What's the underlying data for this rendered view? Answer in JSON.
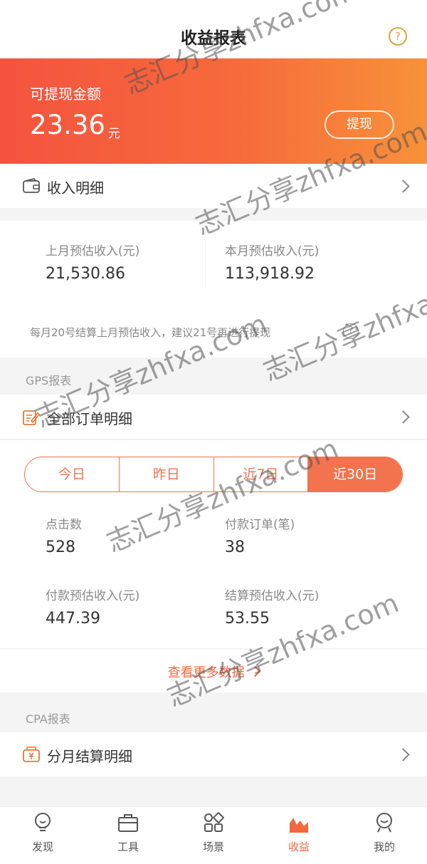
{
  "header": {
    "title": "收益报表",
    "help_symbol": "?"
  },
  "balance": {
    "label": "可提现金额",
    "amount": "23.36",
    "unit": "元",
    "withdraw_label": "提现"
  },
  "income_detail": {
    "label": "收入明细"
  },
  "estimates": {
    "last_month_label": "上月预估收入(元)",
    "last_month_value": "21,530.86",
    "this_month_label": "本月预估收入(元)",
    "this_month_value": "113,918.92",
    "note": "每月20号结算上月预估收入，建议21号再进行提现"
  },
  "gps": {
    "section_label": "GPS报表",
    "orders_label": "全部订单明细"
  },
  "periods": [
    "今日",
    "昨日",
    "近7日",
    "近30日"
  ],
  "active_period": "近30日",
  "stats": {
    "clicks_label": "点击数",
    "clicks_value": "528",
    "paid_orders_label": "付款订单(笔)",
    "paid_orders_value": "38",
    "paid_income_label": "付款预估收入(元)",
    "paid_income_value": "447.39",
    "settled_income_label": "结算预估收入(元)",
    "settled_income_value": "53.55"
  },
  "more_data_label": "查看更多数据",
  "cpa": {
    "section_label": "CPA报表",
    "monthly_label": "分月结算明细"
  },
  "tabs": [
    "发现",
    "工具",
    "场景",
    "收益",
    "我的"
  ],
  "active_tab": "收益",
  "watermark": "志汇分享zhfxa.com",
  "colors": {
    "accent": "#f2734e",
    "banner_start": "#f4533f",
    "banner_end": "#f7923a"
  }
}
